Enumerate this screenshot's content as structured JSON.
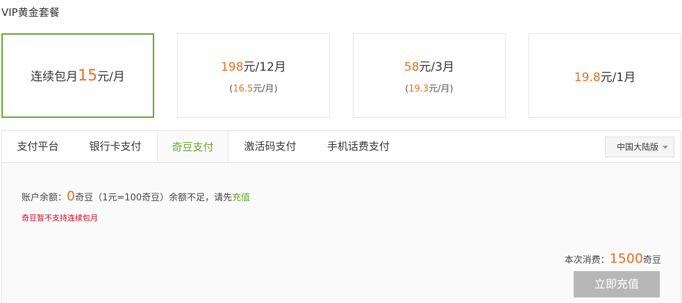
{
  "title": "VIP黄金套餐",
  "plans": [
    {
      "prefix": "连续包月",
      "price": "15",
      "unit": "元/月"
    },
    {
      "price": "198",
      "unit": "元/12月",
      "sub_open": "(",
      "sub_price": "16.5",
      "sub_unit": "元/月)"
    },
    {
      "price": "58",
      "unit": "元/3月",
      "sub_open": "(",
      "sub_price": "19.3",
      "sub_unit": "元/月)"
    },
    {
      "price": "19.8",
      "unit": "元/1月"
    }
  ],
  "tabs": [
    "支付平台",
    "银行卡支付",
    "奇豆支付",
    "激活码支付",
    "手机话费支付"
  ],
  "active_tab": "奇豆支付",
  "region": "中国大陆版",
  "balance": {
    "label": "账户余额：",
    "amount": "0",
    "unit": "奇豆",
    "rate": "（1元=100奇豆）余额不足，请先",
    "link": "充值"
  },
  "warning": "奇豆暂不支持连续包月",
  "cost": {
    "label": "本次消费：",
    "amount": "1500",
    "unit": "奇豆"
  },
  "button": "立即充值",
  "colors": {
    "accent_green": "#66a52e",
    "price_orange": "#f06b1e",
    "warning_red": "#d0021b",
    "button_gray": "#b7b7b7"
  }
}
